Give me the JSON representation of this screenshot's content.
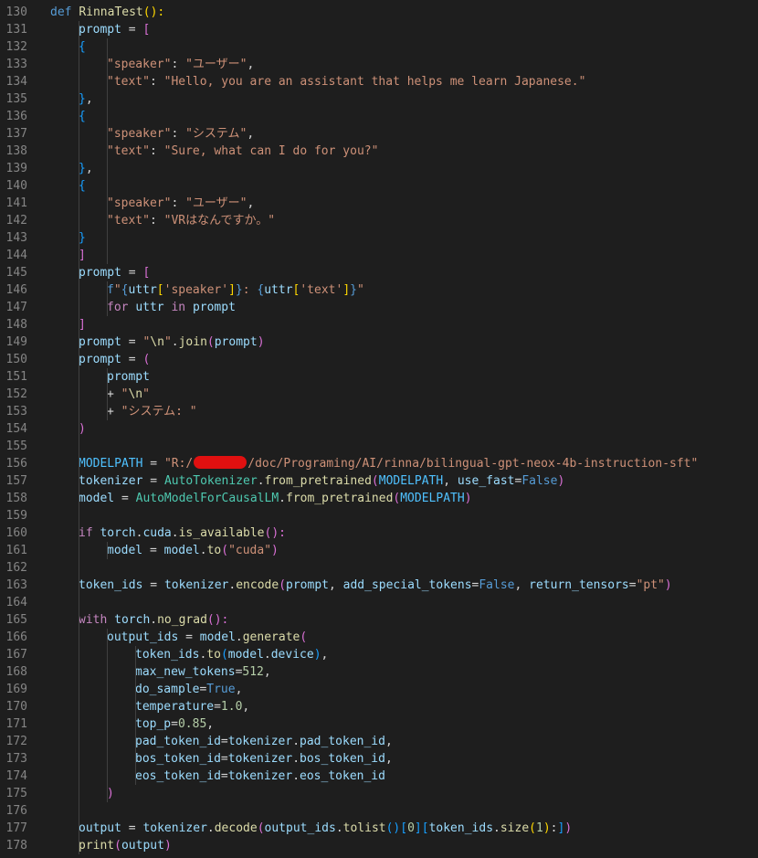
{
  "colors": {
    "background": "#1e1e1e",
    "line_number": "#858585",
    "text": "#d4d4d4",
    "keyword": "#569cd6",
    "control": "#c586c0",
    "function": "#dcdcaa",
    "string": "#ce9178",
    "number": "#b5cea8",
    "class": "#4ec9b0",
    "variable": "#9cdcfe",
    "constant": "#4fc1ff",
    "bracket_gold": "#ffd700",
    "bracket_purple": "#da70d6",
    "bracket_blue": "#179fff",
    "redaction": "#e01010"
  },
  "lines": [
    {
      "no": "130",
      "indent": 0,
      "tokens": [
        [
          "def ",
          "keyword"
        ],
        [
          "RinnaTest",
          "function"
        ],
        [
          "():",
          "bracket_gold"
        ]
      ]
    },
    {
      "no": "131",
      "indent": 1,
      "tokens": [
        [
          "prompt",
          "variable"
        ],
        [
          " = ",
          "text"
        ],
        [
          "[",
          "bracket_purple"
        ]
      ]
    },
    {
      "no": "132",
      "indent": 1,
      "tokens": [
        [
          "{",
          "bracket_blue"
        ]
      ]
    },
    {
      "no": "133",
      "indent": 2,
      "tokens": [
        [
          "\"speaker\"",
          "string"
        ],
        [
          ": ",
          "text"
        ],
        [
          "\"ユーザー\"",
          "string"
        ],
        [
          ",",
          "text"
        ]
      ]
    },
    {
      "no": "134",
      "indent": 2,
      "tokens": [
        [
          "\"text\"",
          "string"
        ],
        [
          ": ",
          "text"
        ],
        [
          "\"Hello, you are an assistant that helps me learn Japanese.\"",
          "string"
        ]
      ]
    },
    {
      "no": "135",
      "indent": 1,
      "tokens": [
        [
          "}",
          "bracket_blue"
        ],
        [
          ",",
          "text"
        ]
      ]
    },
    {
      "no": "136",
      "indent": 1,
      "tokens": [
        [
          "{",
          "bracket_blue"
        ]
      ]
    },
    {
      "no": "137",
      "indent": 2,
      "tokens": [
        [
          "\"speaker\"",
          "string"
        ],
        [
          ": ",
          "text"
        ],
        [
          "\"システム\"",
          "string"
        ],
        [
          ",",
          "text"
        ]
      ]
    },
    {
      "no": "138",
      "indent": 2,
      "tokens": [
        [
          "\"text\"",
          "string"
        ],
        [
          ": ",
          "text"
        ],
        [
          "\"Sure, what can I do for you?\"",
          "string"
        ]
      ]
    },
    {
      "no": "139",
      "indent": 1,
      "tokens": [
        [
          "}",
          "bracket_blue"
        ],
        [
          ",",
          "text"
        ]
      ]
    },
    {
      "no": "140",
      "indent": 1,
      "tokens": [
        [
          "{",
          "bracket_blue"
        ]
      ]
    },
    {
      "no": "141",
      "indent": 2,
      "tokens": [
        [
          "\"speaker\"",
          "string"
        ],
        [
          ": ",
          "text"
        ],
        [
          "\"ユーザー\"",
          "string"
        ],
        [
          ",",
          "text"
        ]
      ]
    },
    {
      "no": "142",
      "indent": 2,
      "tokens": [
        [
          "\"text\"",
          "string"
        ],
        [
          ": ",
          "text"
        ],
        [
          "\"VRはなんですか。\"",
          "string"
        ]
      ]
    },
    {
      "no": "143",
      "indent": 1,
      "tokens": [
        [
          "}",
          "bracket_blue"
        ]
      ]
    },
    {
      "no": "144",
      "indent": 1,
      "tokens": [
        [
          "]",
          "bracket_purple"
        ]
      ]
    },
    {
      "no": "145",
      "indent": 1,
      "tokens": [
        [
          "prompt",
          "variable"
        ],
        [
          " = ",
          "text"
        ],
        [
          "[",
          "bracket_purple"
        ]
      ]
    },
    {
      "no": "146",
      "indent": 2,
      "tokens": [
        [
          "f",
          "keyword"
        ],
        [
          "\"",
          "string"
        ],
        [
          "{",
          "keyword"
        ],
        [
          "uttr",
          "variable"
        ],
        [
          "[",
          "bracket_gold"
        ],
        [
          "'speaker'",
          "string"
        ],
        [
          "]",
          "bracket_gold"
        ],
        [
          "}",
          "keyword"
        ],
        [
          ": ",
          "string"
        ],
        [
          "{",
          "keyword"
        ],
        [
          "uttr",
          "variable"
        ],
        [
          "[",
          "bracket_gold"
        ],
        [
          "'text'",
          "string"
        ],
        [
          "]",
          "bracket_gold"
        ],
        [
          "}",
          "keyword"
        ],
        [
          "\"",
          "string"
        ]
      ]
    },
    {
      "no": "147",
      "indent": 2,
      "tokens": [
        [
          "for",
          "control"
        ],
        [
          " ",
          "text"
        ],
        [
          "uttr",
          "variable"
        ],
        [
          " ",
          "text"
        ],
        [
          "in",
          "control"
        ],
        [
          " ",
          "text"
        ],
        [
          "prompt",
          "variable"
        ]
      ]
    },
    {
      "no": "148",
      "indent": 1,
      "tokens": [
        [
          "]",
          "bracket_purple"
        ]
      ]
    },
    {
      "no": "149",
      "indent": 1,
      "tokens": [
        [
          "prompt",
          "variable"
        ],
        [
          " = ",
          "text"
        ],
        [
          "\"",
          "string"
        ],
        [
          "\\n",
          "function"
        ],
        [
          "\"",
          "string"
        ],
        [
          ".",
          "text"
        ],
        [
          "join",
          "function"
        ],
        [
          "(",
          "bracket_purple"
        ],
        [
          "prompt",
          "variable"
        ],
        [
          ")",
          "bracket_purple"
        ]
      ]
    },
    {
      "no": "150",
      "indent": 1,
      "tokens": [
        [
          "prompt",
          "variable"
        ],
        [
          " = ",
          "text"
        ],
        [
          "(",
          "bracket_purple"
        ]
      ]
    },
    {
      "no": "151",
      "indent": 2,
      "tokens": [
        [
          "prompt",
          "variable"
        ]
      ]
    },
    {
      "no": "152",
      "indent": 2,
      "tokens": [
        [
          "+ ",
          "text"
        ],
        [
          "\"",
          "string"
        ],
        [
          "\\n",
          "function"
        ],
        [
          "\"",
          "string"
        ]
      ]
    },
    {
      "no": "153",
      "indent": 2,
      "tokens": [
        [
          "+ ",
          "text"
        ],
        [
          "\"システム: \"",
          "string"
        ]
      ]
    },
    {
      "no": "154",
      "indent": 1,
      "tokens": [
        [
          ")",
          "bracket_purple"
        ]
      ]
    },
    {
      "no": "155",
      "indent": 0,
      "tokens": []
    },
    {
      "no": "156",
      "indent": 1,
      "tokens": [
        [
          "MODELPATH",
          "constant"
        ],
        [
          " = ",
          "text"
        ],
        [
          "\"R:/",
          "string"
        ],
        [
          "",
          "redact"
        ],
        [
          "/doc/Programing/AI/rinna/bilingual-gpt-neox-4b-instruction-sft\"",
          "string"
        ]
      ]
    },
    {
      "no": "157",
      "indent": 1,
      "tokens": [
        [
          "tokenizer",
          "variable"
        ],
        [
          " = ",
          "text"
        ],
        [
          "AutoTokenizer",
          "class"
        ],
        [
          ".",
          "text"
        ],
        [
          "from_pretrained",
          "function"
        ],
        [
          "(",
          "bracket_purple"
        ],
        [
          "MODELPATH",
          "constant"
        ],
        [
          ", ",
          "text"
        ],
        [
          "use_fast",
          "variable"
        ],
        [
          "=",
          "text"
        ],
        [
          "False",
          "keyword"
        ],
        [
          ")",
          "bracket_purple"
        ]
      ]
    },
    {
      "no": "158",
      "indent": 1,
      "tokens": [
        [
          "model",
          "variable"
        ],
        [
          " = ",
          "text"
        ],
        [
          "AutoModelForCausalLM",
          "class"
        ],
        [
          ".",
          "text"
        ],
        [
          "from_pretrained",
          "function"
        ],
        [
          "(",
          "bracket_purple"
        ],
        [
          "MODELPATH",
          "constant"
        ],
        [
          ")",
          "bracket_purple"
        ]
      ]
    },
    {
      "no": "159",
      "indent": 0,
      "tokens": []
    },
    {
      "no": "160",
      "indent": 1,
      "tokens": [
        [
          "if",
          "control"
        ],
        [
          " ",
          "text"
        ],
        [
          "torch",
          "variable"
        ],
        [
          ".",
          "text"
        ],
        [
          "cuda",
          "variable"
        ],
        [
          ".",
          "text"
        ],
        [
          "is_available",
          "function"
        ],
        [
          "():",
          "bracket_purple"
        ]
      ]
    },
    {
      "no": "161",
      "indent": 2,
      "tokens": [
        [
          "model",
          "variable"
        ],
        [
          " = ",
          "text"
        ],
        [
          "model",
          "variable"
        ],
        [
          ".",
          "text"
        ],
        [
          "to",
          "function"
        ],
        [
          "(",
          "bracket_purple"
        ],
        [
          "\"cuda\"",
          "string"
        ],
        [
          ")",
          "bracket_purple"
        ]
      ]
    },
    {
      "no": "162",
      "indent": 0,
      "tokens": []
    },
    {
      "no": "163",
      "indent": 1,
      "tokens": [
        [
          "token_ids",
          "variable"
        ],
        [
          " = ",
          "text"
        ],
        [
          "tokenizer",
          "variable"
        ],
        [
          ".",
          "text"
        ],
        [
          "encode",
          "function"
        ],
        [
          "(",
          "bracket_purple"
        ],
        [
          "prompt",
          "variable"
        ],
        [
          ", ",
          "text"
        ],
        [
          "add_special_tokens",
          "variable"
        ],
        [
          "=",
          "text"
        ],
        [
          "False",
          "keyword"
        ],
        [
          ", ",
          "text"
        ],
        [
          "return_tensors",
          "variable"
        ],
        [
          "=",
          "text"
        ],
        [
          "\"pt\"",
          "string"
        ],
        [
          ")",
          "bracket_purple"
        ]
      ]
    },
    {
      "no": "164",
      "indent": 0,
      "tokens": []
    },
    {
      "no": "165",
      "indent": 1,
      "tokens": [
        [
          "with",
          "control"
        ],
        [
          " ",
          "text"
        ],
        [
          "torch",
          "variable"
        ],
        [
          ".",
          "text"
        ],
        [
          "no_grad",
          "function"
        ],
        [
          "():",
          "bracket_purple"
        ]
      ]
    },
    {
      "no": "166",
      "indent": 2,
      "tokens": [
        [
          "output_ids",
          "variable"
        ],
        [
          " = ",
          "text"
        ],
        [
          "model",
          "variable"
        ],
        [
          ".",
          "text"
        ],
        [
          "generate",
          "function"
        ],
        [
          "(",
          "bracket_purple"
        ]
      ]
    },
    {
      "no": "167",
      "indent": 3,
      "tokens": [
        [
          "token_ids",
          "variable"
        ],
        [
          ".",
          "text"
        ],
        [
          "to",
          "function"
        ],
        [
          "(",
          "bracket_blue"
        ],
        [
          "model",
          "variable"
        ],
        [
          ".",
          "text"
        ],
        [
          "device",
          "variable"
        ],
        [
          ")",
          "bracket_blue"
        ],
        [
          ",",
          "text"
        ]
      ]
    },
    {
      "no": "168",
      "indent": 3,
      "tokens": [
        [
          "max_new_tokens",
          "variable"
        ],
        [
          "=",
          "text"
        ],
        [
          "512",
          "number"
        ],
        [
          ",",
          "text"
        ]
      ]
    },
    {
      "no": "169",
      "indent": 3,
      "tokens": [
        [
          "do_sample",
          "variable"
        ],
        [
          "=",
          "text"
        ],
        [
          "True",
          "keyword"
        ],
        [
          ",",
          "text"
        ]
      ]
    },
    {
      "no": "170",
      "indent": 3,
      "tokens": [
        [
          "temperature",
          "variable"
        ],
        [
          "=",
          "text"
        ],
        [
          "1.0",
          "number"
        ],
        [
          ",",
          "text"
        ]
      ]
    },
    {
      "no": "171",
      "indent": 3,
      "tokens": [
        [
          "top_p",
          "variable"
        ],
        [
          "=",
          "text"
        ],
        [
          "0.85",
          "number"
        ],
        [
          ",",
          "text"
        ]
      ]
    },
    {
      "no": "172",
      "indent": 3,
      "tokens": [
        [
          "pad_token_id",
          "variable"
        ],
        [
          "=",
          "text"
        ],
        [
          "tokenizer",
          "variable"
        ],
        [
          ".",
          "text"
        ],
        [
          "pad_token_id",
          "variable"
        ],
        [
          ",",
          "text"
        ]
      ]
    },
    {
      "no": "173",
      "indent": 3,
      "tokens": [
        [
          "bos_token_id",
          "variable"
        ],
        [
          "=",
          "text"
        ],
        [
          "tokenizer",
          "variable"
        ],
        [
          ".",
          "text"
        ],
        [
          "bos_token_id",
          "variable"
        ],
        [
          ",",
          "text"
        ]
      ]
    },
    {
      "no": "174",
      "indent": 3,
      "tokens": [
        [
          "eos_token_id",
          "variable"
        ],
        [
          "=",
          "text"
        ],
        [
          "tokenizer",
          "variable"
        ],
        [
          ".",
          "text"
        ],
        [
          "eos_token_id",
          "variable"
        ]
      ]
    },
    {
      "no": "175",
      "indent": 2,
      "tokens": [
        [
          ")",
          "bracket_purple"
        ]
      ]
    },
    {
      "no": "176",
      "indent": 0,
      "tokens": []
    },
    {
      "no": "177",
      "indent": 1,
      "tokens": [
        [
          "output",
          "variable"
        ],
        [
          " = ",
          "text"
        ],
        [
          "tokenizer",
          "variable"
        ],
        [
          ".",
          "text"
        ],
        [
          "decode",
          "function"
        ],
        [
          "(",
          "bracket_purple"
        ],
        [
          "output_ids",
          "variable"
        ],
        [
          ".",
          "text"
        ],
        [
          "tolist",
          "function"
        ],
        [
          "()",
          "bracket_blue"
        ],
        [
          "[",
          "bracket_blue"
        ],
        [
          "0",
          "number"
        ],
        [
          "]",
          "bracket_blue"
        ],
        [
          "[",
          "bracket_blue"
        ],
        [
          "token_ids",
          "variable"
        ],
        [
          ".",
          "text"
        ],
        [
          "size",
          "function"
        ],
        [
          "(",
          "bracket_gold"
        ],
        [
          "1",
          "number"
        ],
        [
          ")",
          "bracket_gold"
        ],
        [
          ":",
          "text"
        ],
        [
          "]",
          "bracket_blue"
        ],
        [
          ")",
          "bracket_purple"
        ]
      ]
    },
    {
      "no": "178",
      "indent": 1,
      "tokens": [
        [
          "print",
          "function"
        ],
        [
          "(",
          "bracket_purple"
        ],
        [
          "output",
          "variable"
        ],
        [
          ")",
          "bracket_purple"
        ]
      ]
    }
  ]
}
